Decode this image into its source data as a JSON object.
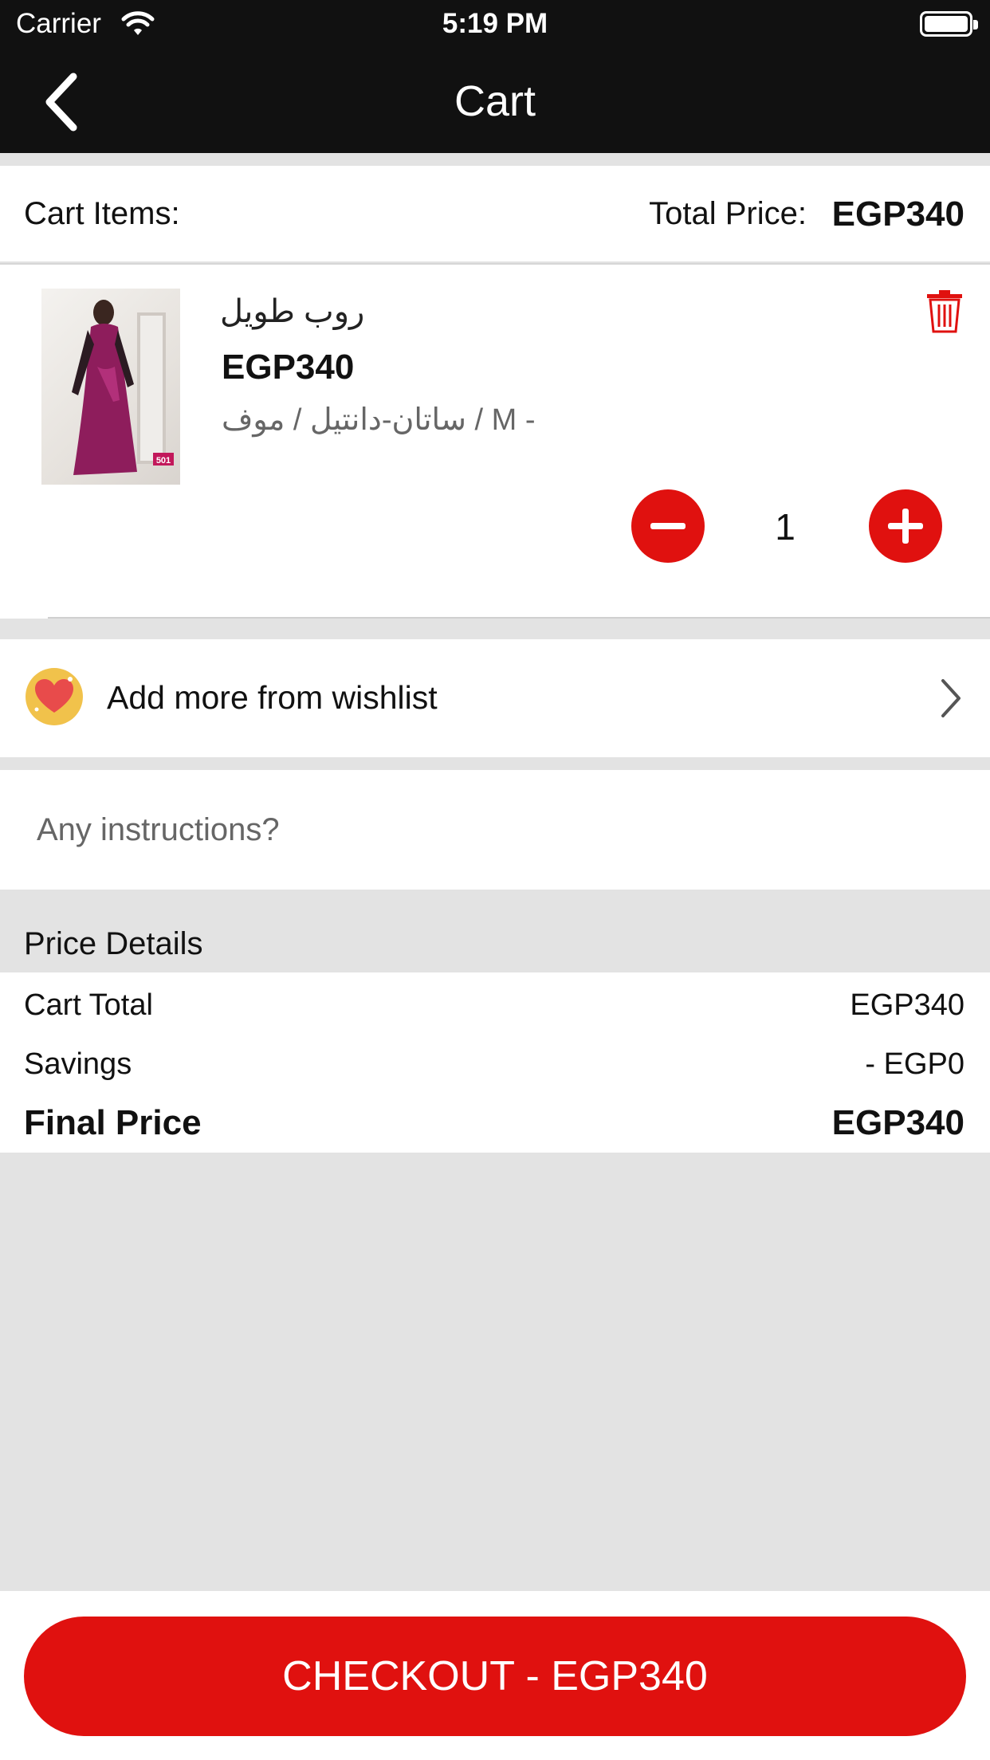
{
  "status_bar": {
    "carrier": "Carrier",
    "time": "5:19 PM"
  },
  "nav": {
    "title": "Cart",
    "back_icon": "chevron-left-icon"
  },
  "cart_header": {
    "items_label": "Cart Items:",
    "total_label": "Total Price:",
    "total_value": "EGP340"
  },
  "items": [
    {
      "name": "روب طويل",
      "price": "EGP340",
      "variant": "ساتان-دانتيل / موف / M -",
      "quantity": "1",
      "image_badge": "501"
    }
  ],
  "wishlist": {
    "label": "Add more from wishlist",
    "icon": "heart-icon"
  },
  "instructions": {
    "placeholder": "Any instructions?"
  },
  "price_details": {
    "title": "Price Details",
    "rows": [
      {
        "label": "Cart Total",
        "value": "EGP340"
      },
      {
        "label": "Savings",
        "value": "- EGP0"
      },
      {
        "label": "Final Price",
        "value": "EGP340"
      }
    ]
  },
  "checkout": {
    "label": "CHECKOUT - EGP340"
  },
  "colors": {
    "accent": "#e0110f",
    "topbar": "#111111",
    "background": "#e3e3e3"
  }
}
